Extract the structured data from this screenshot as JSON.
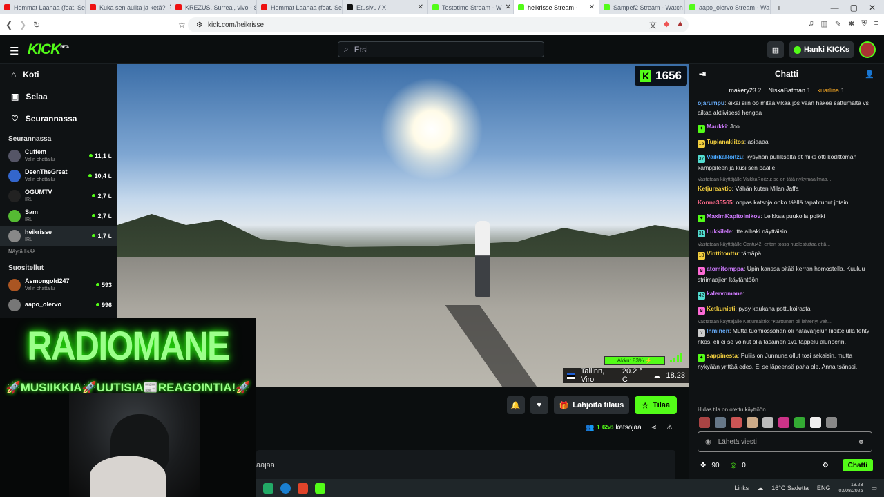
{
  "browser": {
    "tabs": [
      {
        "label": "Hommat Laahaa (feat. Se",
        "color": "#e11"
      },
      {
        "label": "Kuka sen aulita ja ketä?",
        "color": "#e11"
      },
      {
        "label": "KREZUS, Surreal, vivo - S",
        "color": "#e11"
      },
      {
        "label": "Hommat Laahaa (feat. Se",
        "color": "#e11"
      },
      {
        "label": "Etusivu / X",
        "color": "#111"
      },
      {
        "label": "Testotimo Stream - W",
        "color": "#53fc18"
      },
      {
        "label": "heikrisse Stream -",
        "color": "#53fc18",
        "active": true
      },
      {
        "label": "Sampef2 Stream - Watch",
        "color": "#53fc18"
      },
      {
        "label": "aapo_olervo Stream - Wa",
        "color": "#53fc18"
      }
    ],
    "new_tab": "+",
    "url": "kick.com/heikrisse"
  },
  "header": {
    "logo": "KICK",
    "logo_sup": "BETA",
    "search_placeholder": "Etsi",
    "kicks_label": "Hanki KICKs"
  },
  "sidebar": {
    "nav": [
      {
        "label": "Koti",
        "icon": "⌂"
      },
      {
        "label": "Selaa",
        "icon": "▣"
      },
      {
        "label": "Seurannassa",
        "icon": "♡"
      }
    ],
    "following_title": "Seurannassa",
    "following": [
      {
        "name": "Cuffem",
        "cat": "Valin chattailu",
        "viewers": "11,1 t.",
        "color": "#556"
      },
      {
        "name": "DeenTheGreat",
        "cat": "Valin chattailu",
        "viewers": "10,4 t.",
        "color": "#36c"
      },
      {
        "name": "OGUMTV",
        "cat": "IRL",
        "viewers": "2,7 t.",
        "color": "#222"
      },
      {
        "name": "Sam",
        "cat": "IRL",
        "viewers": "2,7 t.",
        "color": "#5b3"
      },
      {
        "name": "heikrisse",
        "cat": "IRL",
        "viewers": "1,7 t.",
        "color": "#888",
        "selected": true
      }
    ],
    "show_more": "Näytä lisää",
    "recommended_title": "Suositellut",
    "recommended": [
      {
        "name": "Asmongold247",
        "cat": "Valin chattailu",
        "viewers": "593",
        "color": "#a52"
      },
      {
        "name": "aapo_olervo",
        "cat": "",
        "viewers": "996",
        "color": "#777"
      }
    ]
  },
  "video": {
    "viewer_count": "1656",
    "battery": "Akku: 83% ⚡",
    "location": "Tallinn, Viro",
    "temp": "20.2 ° C",
    "time": "18.23"
  },
  "overlay": {
    "title": "RADIOMANE",
    "tagline": "🚀MUSIIKKIA🚀UUTISIA📰REAGOINTIA!🚀"
  },
  "stream_actions": {
    "gift_label": "Lahjoita tilaus",
    "follow_label": "Tilaa",
    "viewers_num": "1 656",
    "viewers_label": "katsojaa",
    "about_text": "aajaa"
  },
  "chat": {
    "title": "Chatti",
    "leaders": [
      {
        "name": "makery23",
        "n": "2"
      },
      {
        "name": "NiskaBatman",
        "n": "1"
      },
      {
        "name": "kuarlina",
        "n": "1"
      }
    ],
    "messages": [
      {
        "user": "ojarumpu",
        "color": "#6ab0ff",
        "text": "eikai siin oo mitaa vikaa jos vaan hakee sattumalta vs aikaa aktiivisesti hengaa"
      },
      {
        "user": "Maukki",
        "color": "#d07bff",
        "badge": "✦",
        "badgeColor": "#53fc18",
        "text": "Joo"
      },
      {
        "user": "Tupianakiitos",
        "color": "#f4d03f",
        "badge": "15",
        "badgeColor": "#f4d03f",
        "text": "asiaaaa"
      },
      {
        "user": "VaikkaRoitzu",
        "color": "#4aa8ff",
        "badge": "37",
        "badgeColor": "#53dcd0",
        "text": "kysyhän pullikselta et miks otti kodittoman kämppileen ja kusi sen päälle"
      },
      {
        "reply": "Vastataan käyttäjälle VaikkaRoitzu: se on tätä nykymaailmaa...",
        "user": "Ketjureaktio",
        "color": "#f4d03f",
        "text": "Vähän kuten Milan Jaffa"
      },
      {
        "user": "Konna35565",
        "color": "#ff6b8b",
        "text": "onpas katsoja onko täällä tapahtunut jotain"
      },
      {
        "user": "MaximKapitolnikov",
        "color": "#d07bff",
        "badge": "✦",
        "badgeColor": "#53fc18",
        "text": "Leikkaa puukolla poikki"
      },
      {
        "user": "Lukkilele",
        "color": "#d07bff",
        "badge": "31",
        "badgeColor": "#53dcd0",
        "text": "itte aihaki näyttäisin"
      },
      {
        "reply": "Vastataan käyttäjälle Cantu42: entan tossa huolestuttaa että...",
        "user": "Vinttitonttu",
        "color": "#f4d03f",
        "badge": "18",
        "badgeColor": "#f4d03f",
        "text": "tämäpä"
      },
      {
        "user": "atomitomppa",
        "color": "#d07bff",
        "badge": "☯",
        "badgeColor": "#ff6bd6",
        "text": "Upin kanssa pitää kerran homostella. Kuuluu striimaajien käytäntöön"
      },
      {
        "user": "kalervomane",
        "color": "#d07bff",
        "badge": "42",
        "badgeColor": "#53dcd0",
        "text": ""
      },
      {
        "user": "Ketkunisti",
        "color": "#f4d03f",
        "badge": "☯",
        "badgeColor": "#ff6bd6",
        "text": "pysy kaukana pottukoirasta"
      },
      {
        "reply": "Vastataan käyttäjälle Ketjureaktio: \"Karttunen oli lähtenyt veit...",
        "user": "Ihminen",
        "color": "#6ab0ff",
        "badge": "?",
        "badgeColor": "#ccc",
        "text": "Mutta tuomiossahan oli hätävarjelun liioittelulla tehty rikos, eli ei se voinut olla tasainen 1v1 tappelu alunperin."
      },
      {
        "user": "sappinesta",
        "color": "#f4d03f",
        "badge": "✦",
        "badgeColor": "#53fc18",
        "text": "Puliis on Junnuna ollut tosi sekaisin, mutta nykyään yrittää edes. Ei se läpeensä paha ole. Anna tsänssi."
      }
    ],
    "slow_mode": "Hidas tila on otettu käyttöön.",
    "input_placeholder": "Lähetä viesti",
    "points_a": "90",
    "points_b": "0",
    "send_label": "Chatti"
  },
  "taskbar": {
    "links": "Links",
    "weather": "16°C Sadetta",
    "lang": "ENG",
    "time": "18.23",
    "date": "03/08/2026"
  }
}
